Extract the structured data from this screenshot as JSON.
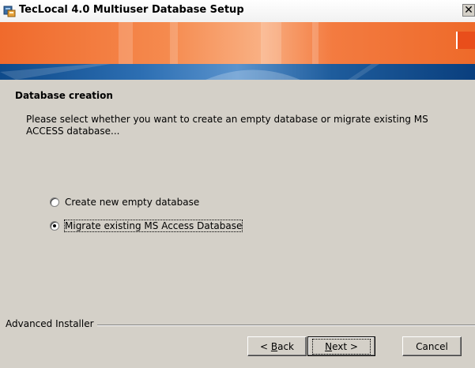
{
  "window": {
    "title": "TecLocal 4.0 Multiuser Database Setup",
    "close_glyph": "✕"
  },
  "header": {
    "accent_orange": "#f06a2c",
    "accent_blue": "#1e5c9c"
  },
  "page": {
    "section_title": "Database creation",
    "description": "Please select whether you want to create an empty database or migrate existing MS ACCESS database..."
  },
  "options": [
    {
      "label": "Create new empty database",
      "selected": false
    },
    {
      "label": "Migrate existing MS Access Database",
      "selected": true
    }
  ],
  "footer": {
    "group_label": "Advanced Installer"
  },
  "buttons": {
    "back_prefix": "< ",
    "back_mnemonic": "B",
    "back_rest": "ack",
    "next_mnemonic": "N",
    "next_rest": "ext >",
    "cancel": "Cancel"
  }
}
